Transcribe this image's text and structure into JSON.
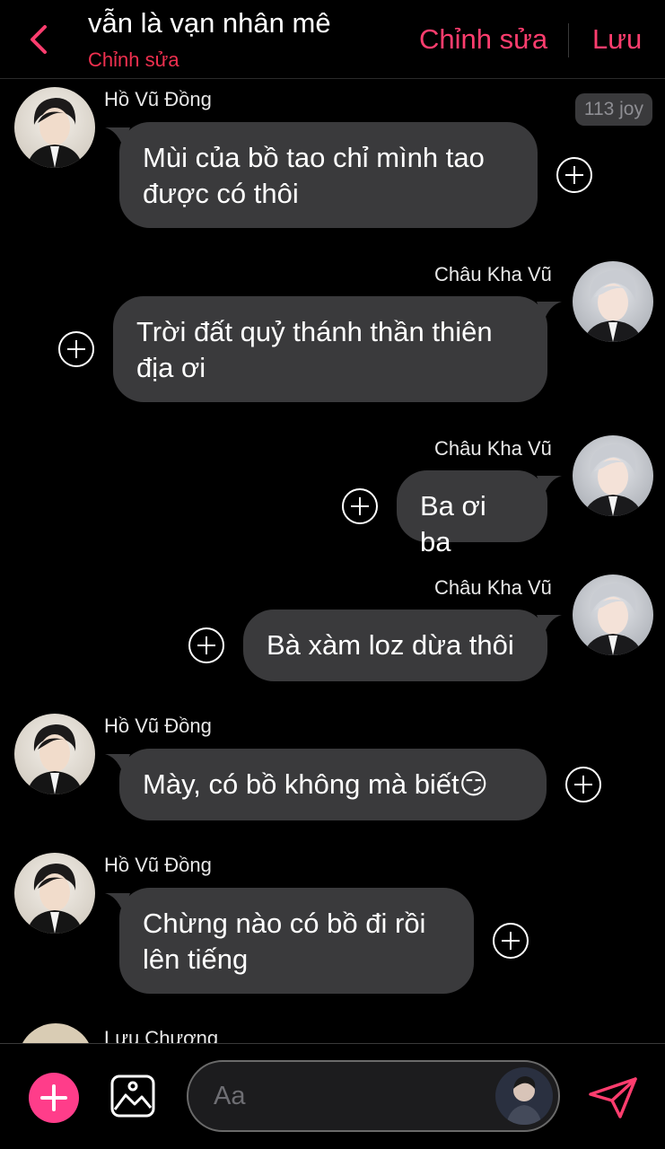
{
  "header": {
    "title": "vẫn là vạn nhân mê",
    "subtitle": "Chỉnh sửa",
    "edit_label": "Chỉnh sửa",
    "save_label": "Lưu"
  },
  "badge": "113 joy",
  "messages": [
    {
      "sender": "Hồ Vũ Đồng",
      "lines": [
        "Mùi của bồ tao chỉ mình tao",
        "được có thôi"
      ]
    },
    {
      "sender": "Châu Kha Vũ",
      "lines": [
        "Trời đất quỷ thánh thần thiên",
        "địa ơi"
      ]
    },
    {
      "sender": "Châu Kha Vũ",
      "lines": [
        "Ba ơi ba"
      ]
    },
    {
      "sender": "Châu Kha Vũ",
      "lines": [
        "Bà xàm loz dừa thôi"
      ]
    },
    {
      "sender": "Hồ Vũ Đồng",
      "lines": [
        "Mày, có bồ không mà biết😏"
      ]
    },
    {
      "sender": "Hồ Vũ Đồng",
      "lines": [
        "Chừng nào có bồ đi rồi",
        "lên tiếng"
      ]
    }
  ],
  "partial_sender": "Lưu Chương",
  "composer": {
    "placeholder": "Aa"
  },
  "colors": {
    "accent": "#ff3d6e",
    "subtitle": "#f0304f",
    "bubble": "#3a3a3c",
    "background": "#000000"
  },
  "icons": [
    "back-chevron-icon",
    "add-reaction-icon",
    "add-icon",
    "image-icon",
    "send-icon"
  ]
}
